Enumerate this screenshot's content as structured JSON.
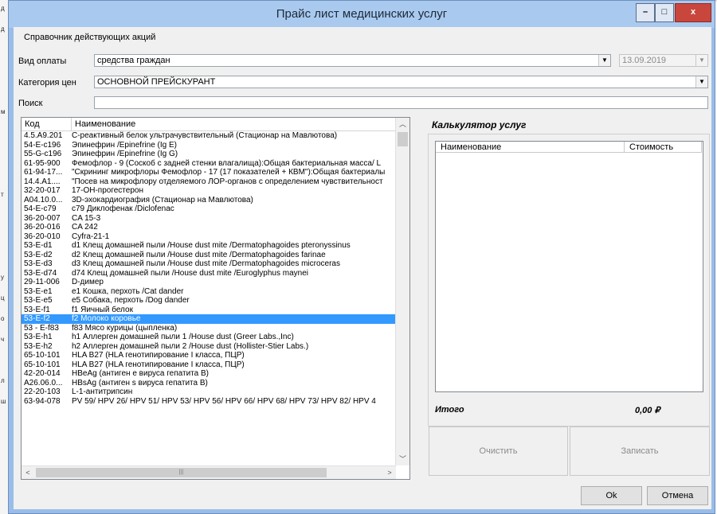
{
  "window": {
    "title": "Прайс лист медицинских услуг",
    "minimize_glyph": "–",
    "maximize_glyph": "□",
    "close_glyph": "x"
  },
  "background_strip_letters": [
    "д",
    "д",
    "",
    "",
    "",
    "м",
    "",
    "",
    "",
    "т",
    "",
    "",
    "",
    "у",
    "ц",
    "о",
    "ч",
    "",
    "л",
    "ш",
    "",
    "",
    ""
  ],
  "menu": {
    "item": "Справочник действующих акций"
  },
  "payment": {
    "label": "Вид оплаты",
    "value": "средства граждан",
    "date": "13.09.2019"
  },
  "price_category": {
    "label": "Категория цен",
    "value": "ОСНОВНОЙ ПРЕЙСКУРАНТ"
  },
  "search": {
    "label": "Поиск",
    "value": ""
  },
  "services_list": {
    "col_code": "Код",
    "col_name": "Наименование",
    "rows": [
      {
        "code": "4.5.A9.201",
        "name": "С-реактивный белок ультрачувствительный (Стационар на Мавлютова)"
      },
      {
        "code": "54-E-c196",
        "name": "Эпинефрин /Epinefrine (Ig E)"
      },
      {
        "code": "55-G-c196",
        "name": "Эпинефрин /Epinefrine (Ig G)"
      },
      {
        "code": "61-95-900",
        "name": "Фемофлор - 9 (Соскоб с задней стенки влагалища):Общая бактериальная масса/ L"
      },
      {
        "code": "61-94-17...",
        "name": "\"Скрининг микрофлоры Фемофлор - 17 (17 показателей + КВМ\"):Общая бактериалы"
      },
      {
        "code": "14.4.A1....",
        "name": "\"Посев на микрофлору отделяемого ЛОР-органов с определением чувствительност"
      },
      {
        "code": "32-20-017",
        "name": "17-ОН-прогестерон"
      },
      {
        "code": "A04.10.0...",
        "name": "3D-эхокардиография  (Стационар на Мавлютова)"
      },
      {
        "code": "54-E-c79",
        "name": "c79 Диклофенак /Diclofenac"
      },
      {
        "code": "36-20-007",
        "name": "CA 15-3"
      },
      {
        "code": "36-20-016",
        "name": "CA 242"
      },
      {
        "code": "36-20-010",
        "name": "Cyfra-21-1"
      },
      {
        "code": "53-E-d1",
        "name": "d1 Клещ домашней пыли /House dust mite /Dermatophagoides pteronyssinus"
      },
      {
        "code": "53-E-d2",
        "name": "d2 Клещ домашней пыли /House dust mite /Dermatophagoides farinae"
      },
      {
        "code": "53-E-d3",
        "name": "d3 Клещ домашней пыли /House dust mite /Dermatophagoides microceras"
      },
      {
        "code": "53-E-d74",
        "name": "d74 Клещ домашней пыли /House dust mite /Euroglyphus maynei"
      },
      {
        "code": "29-11-006",
        "name": "D-димер"
      },
      {
        "code": "53-E-e1",
        "name": "e1 Кошка, перхоть /Cat dander"
      },
      {
        "code": "53-E-e5",
        "name": "e5 Собака, перхоть /Dog dander"
      },
      {
        "code": "53-E-f1",
        "name": "f1 Яичный белок"
      },
      {
        "code": "53-E-f2",
        "name": "f2 Молоко коровье"
      },
      {
        "code": "53 - E-f83",
        "name": "f83 Мясо курицы (цыпленка)"
      },
      {
        "code": "53-E-h1",
        "name": "h1 Аллерген домашней пыли 1 /House dust (Greer Labs.,Inc)"
      },
      {
        "code": "53-E-h2",
        "name": "h2 Аллерген домашней пыли 2 /House dust (Hollister-Stier Labs.)"
      },
      {
        "code": "65-10-101",
        "name": "HLA B27 (HLA генотипирование I класса, ПЦР)"
      },
      {
        "code": "65-10-101",
        "name": "HLA B27 (HLA генотипирование I класса, ПЦР)"
      },
      {
        "code": "42-20-014",
        "name": "HBeAg (антиген е вируса гепатита В)"
      },
      {
        "code": "A26.06.0...",
        "name": "HBsAg (антиген s вируса гепатита В)"
      },
      {
        "code": "22-20-103",
        "name": "L-1-антитрипсин"
      },
      {
        "code": "63-94-078",
        "name": "PV 59/ HPV 26/ HPV 51/ HPV 53/ HPV 56/ HPV 66/ HPV 68/ HPV 73/ HPV 82/ HPV 4"
      }
    ],
    "selected_index": 20
  },
  "calculator": {
    "title": "Калькулятор услуг",
    "col_name": "Наименование",
    "col_cost": "Стоимость",
    "total_label": "Итого",
    "total_value": "0,00 ₽"
  },
  "buttons": {
    "clear": "Очистить",
    "save": "Записать",
    "ok": "Ok",
    "cancel": "Отмена"
  }
}
